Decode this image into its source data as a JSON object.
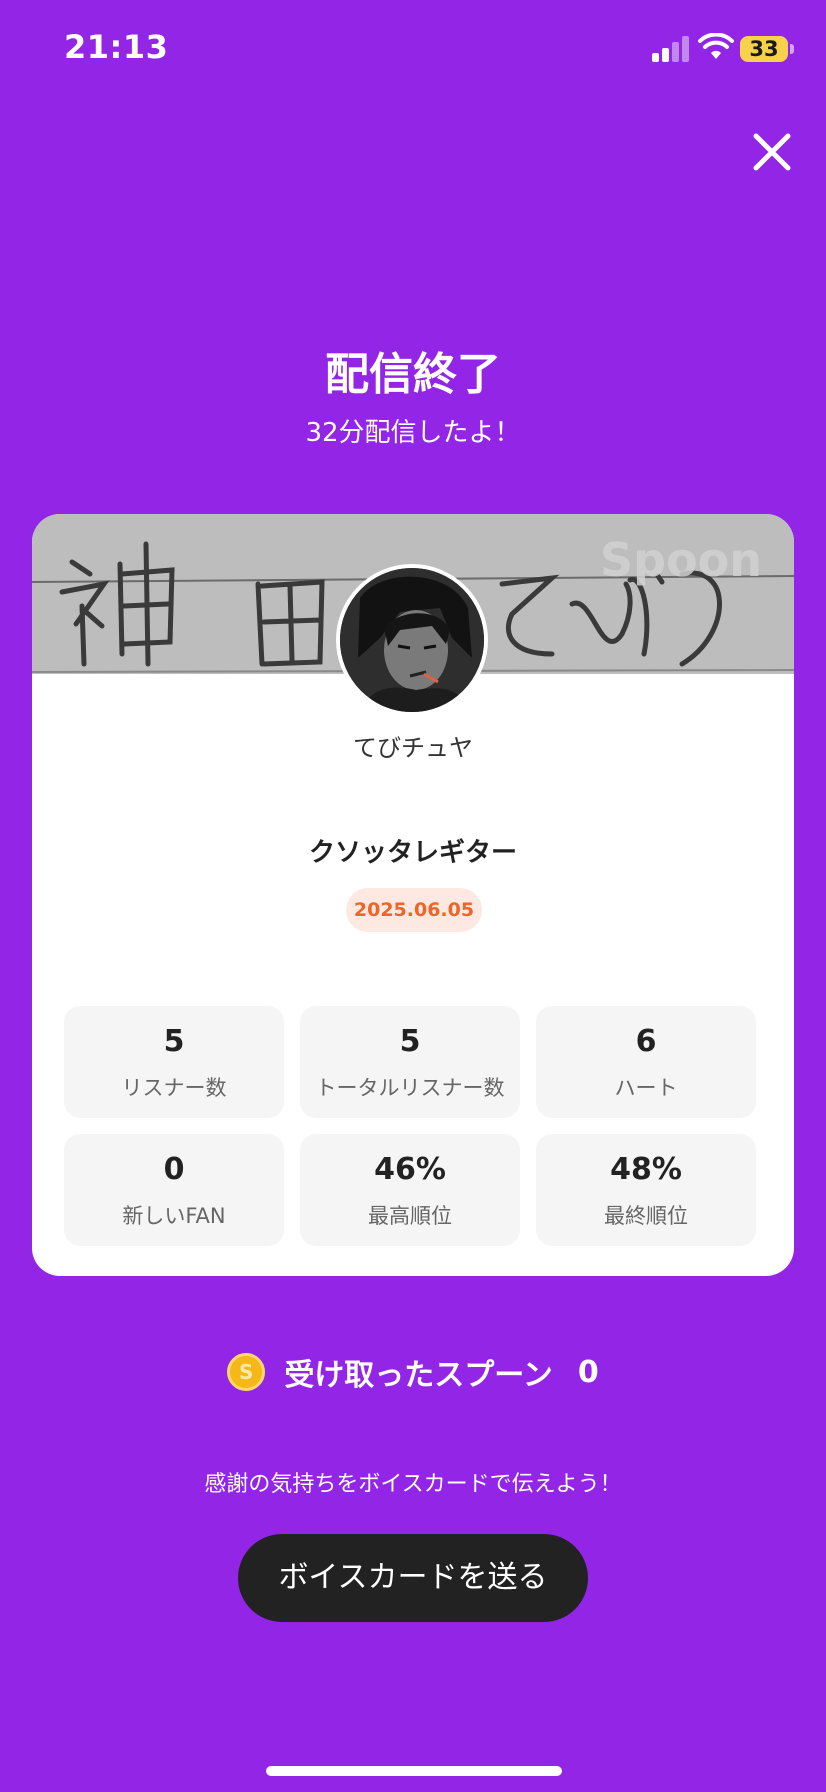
{
  "status_bar": {
    "time": "21:13",
    "battery": "33",
    "icons": [
      "signal-icon",
      "wifi-icon",
      "battery-icon"
    ]
  },
  "header": {
    "close_icon": "close-icon",
    "title": "配信終了",
    "subtitle": "32分配信したよ！"
  },
  "card": {
    "banner_handwriting": "神田てぴり",
    "banner_watermark": "Spoon",
    "host_name": "てびチュヤ",
    "stream_title": "クソッタレギター",
    "date": "2025.06.05",
    "stats": [
      {
        "value": "5",
        "label": "リスナー数"
      },
      {
        "value": "5",
        "label": "トータルリスナー数"
      },
      {
        "value": "6",
        "label": "ハート"
      },
      {
        "value": "0",
        "label": "新しいFAN"
      },
      {
        "value": "46%",
        "label": "最高順位"
      },
      {
        "value": "48%",
        "label": "最終順位"
      }
    ]
  },
  "spoons": {
    "icon": "coin-icon",
    "coin_glyph": "S",
    "label": "受け取ったスプーン",
    "count": "0"
  },
  "footer": {
    "thanks_text": "感謝の気持ちをボイスカードで伝えよう！",
    "voice_card_button": "ボイスカードを送る"
  },
  "colors": {
    "background": "#9325e6",
    "badge_text": "#f06428",
    "badge_bg": "#fde9e2",
    "button_bg": "#222222",
    "coin": "#f6b718"
  }
}
